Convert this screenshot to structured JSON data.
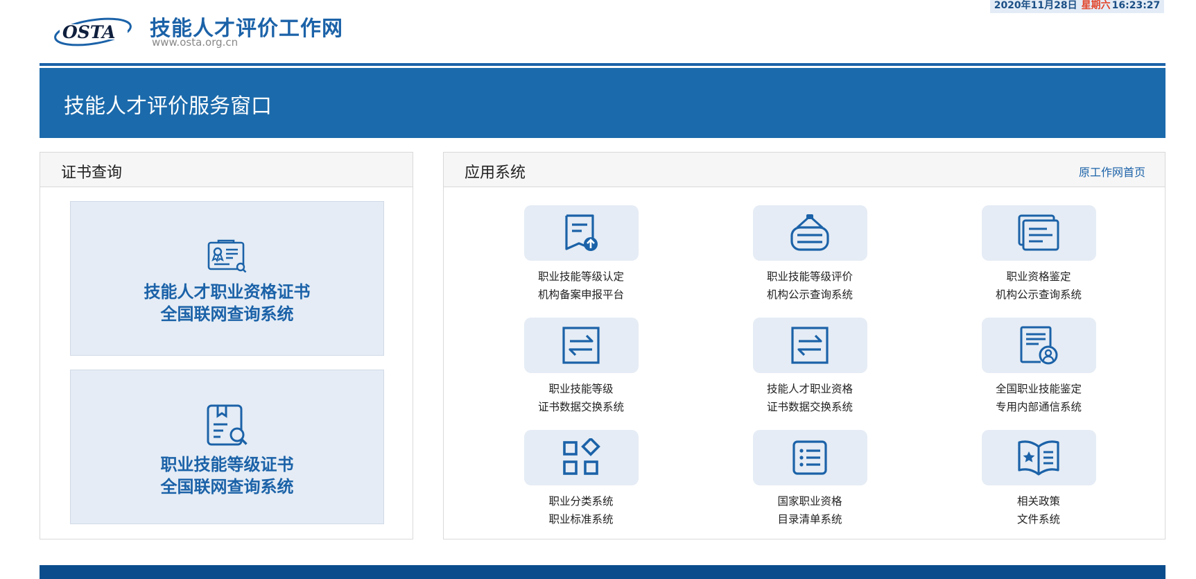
{
  "header": {
    "logo_text": "OSTA",
    "site_title": "技能人才评价工作网",
    "site_url": "www.osta.org.cn",
    "date": "2020年11月28日",
    "weekday": "星期六",
    "time": "16:23:27"
  },
  "banner": {
    "title": "技能人才评价服务窗口"
  },
  "cert_panel": {
    "title": "证书查询",
    "cards": [
      {
        "line1": "技能人才职业资格证书",
        "line2": "全国联网查询系统",
        "icon": "certificate-search-icon"
      },
      {
        "line1": "职业技能等级证书",
        "line2": "全国联网查询系统",
        "icon": "document-search-icon"
      }
    ]
  },
  "apps_panel": {
    "title": "应用系统",
    "link": "原工作网首页",
    "items": [
      {
        "line1": "职业技能等级认定",
        "line2": "机构备案申报平台",
        "icon": "document-upload-icon"
      },
      {
        "line1": "职业技能等级评价",
        "line2": "机构公示查询系统",
        "icon": "signboard-icon"
      },
      {
        "line1": "职业资格鉴定",
        "line2": "机构公示查询系统",
        "icon": "stacked-documents-icon"
      },
      {
        "line1": "职业技能等级",
        "line2": "证书数据交换系统",
        "icon": "exchange-arrows-icon"
      },
      {
        "line1": "技能人才职业资格",
        "line2": "证书数据交换系统",
        "icon": "exchange-arrows-icon"
      },
      {
        "line1": "全国职业技能鉴定",
        "line2": "专用内部通信系统",
        "icon": "document-user-icon"
      },
      {
        "line1": "职业分类系统",
        "line2": "职业标准系统",
        "icon": "category-grid-icon"
      },
      {
        "line1": "国家职业资格",
        "line2": "目录清单系统",
        "icon": "list-icon"
      },
      {
        "line1": "相关政策",
        "line2": "文件系统",
        "icon": "policy-book-icon"
      }
    ]
  },
  "colors": {
    "brand_blue": "#1b6aab",
    "tile_bg": "#e5ecf5",
    "weekday_red": "#e2452b",
    "footer_blue": "#0b4d8c"
  }
}
